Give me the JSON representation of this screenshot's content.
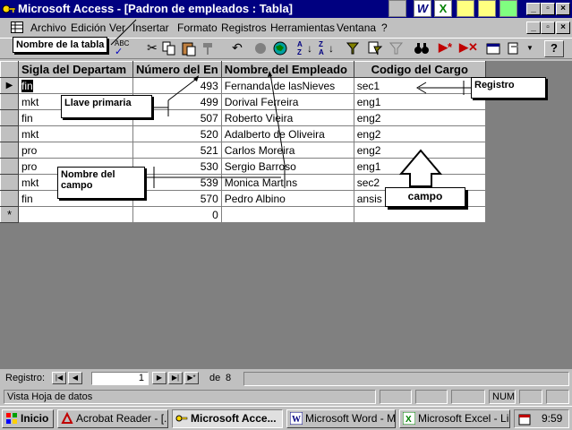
{
  "window": {
    "title": "Microsoft Access - [Padron de empleados : Tabla]"
  },
  "menu": {
    "items": [
      "Archivo",
      "Edición",
      "Ver",
      "Insertar",
      "Formato",
      "Registros",
      "Herramientas",
      "Ventana",
      "?"
    ]
  },
  "table": {
    "columns": [
      "Sigla del Departam",
      "Número del En",
      "Nombre del Empleado",
      "Codigo del Cargo"
    ],
    "rows": [
      [
        "fin",
        "493",
        "Fernanda de lasNieves",
        "sec1"
      ],
      [
        "mkt",
        "499",
        "Dorival Ferreira",
        "eng1"
      ],
      [
        "fin",
        "507",
        "Roberto Vieira",
        "eng2"
      ],
      [
        "mkt",
        "520",
        "Adalberto de Oliveira",
        "eng2"
      ],
      [
        "pro",
        "521",
        "Carlos Moreira",
        "eng2"
      ],
      [
        "pro",
        "530",
        "Sergio Barroso",
        "eng1"
      ],
      [
        "mkt",
        "539",
        "Monica Martins",
        "sec2"
      ],
      [
        "fin",
        "570",
        "Pedro Albino",
        "ansis"
      ]
    ],
    "new_row": [
      "",
      "0",
      "",
      ""
    ],
    "new_row_marker": "*"
  },
  "annotations": {
    "table_name": "Nombre de la tabla",
    "primary_key": "Llave primaria",
    "field_name": "Nombre del campo",
    "record": "Registro",
    "field": "campo"
  },
  "navigation": {
    "label": "Registro:",
    "current": "1",
    "of_label": "de",
    "total": "8"
  },
  "status": {
    "text": "Vista Hoja de datos",
    "num": "NUM"
  },
  "taskbar": {
    "start": "Inicio",
    "tasks": [
      "Acrobat Reader - [...",
      "Microsoft Acce...",
      "Microsoft Word - M...",
      "Microsoft Excel - Li..."
    ],
    "clock": "9:59"
  }
}
